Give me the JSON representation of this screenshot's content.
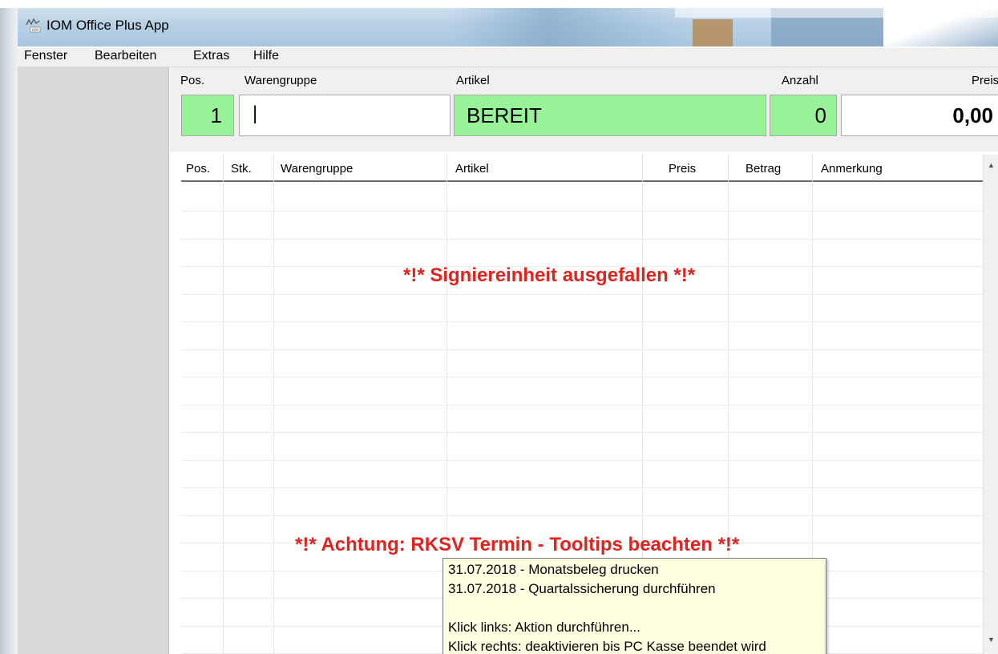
{
  "window": {
    "title": "IOM Office Plus App",
    "icon": "app-logo-icon"
  },
  "menu": [
    "Fenster",
    "Bearbeiten",
    "Extras",
    "Hilfe"
  ],
  "input_labels": {
    "pos": "Pos.",
    "warengruppe": "Warengruppe",
    "artikel": "Artikel",
    "anzahl": "Anzahl",
    "preis": "Preis"
  },
  "input_values": {
    "pos": "1",
    "warengruppe": "|",
    "artikel": "BEREIT",
    "anzahl": "0",
    "preis": "0,00"
  },
  "grid_columns": [
    "Pos.",
    "Stk.",
    "Warengruppe",
    "Artikel",
    "Preis",
    "Betrag",
    "Anmerkung"
  ],
  "messages": {
    "signature": "*!* Signiereinheit ausgefallen *!*",
    "rksv": "*!* Achtung: RKSV Termin - Tooltips beachten *!*"
  },
  "tooltip": {
    "line1": "31.07.2018 - Monatsbeleg drucken",
    "line2": "31.07.2018 - Quartalssicherung durchführen",
    "line3": "Klick links: Aktion durchführen...",
    "line4": "Klick rechts: deaktivieren bis PC Kasse beendet wird"
  },
  "colors": {
    "green_field": "#98f398",
    "warning_red": "#e3221d",
    "tooltip_bg": "#ffffe1"
  }
}
